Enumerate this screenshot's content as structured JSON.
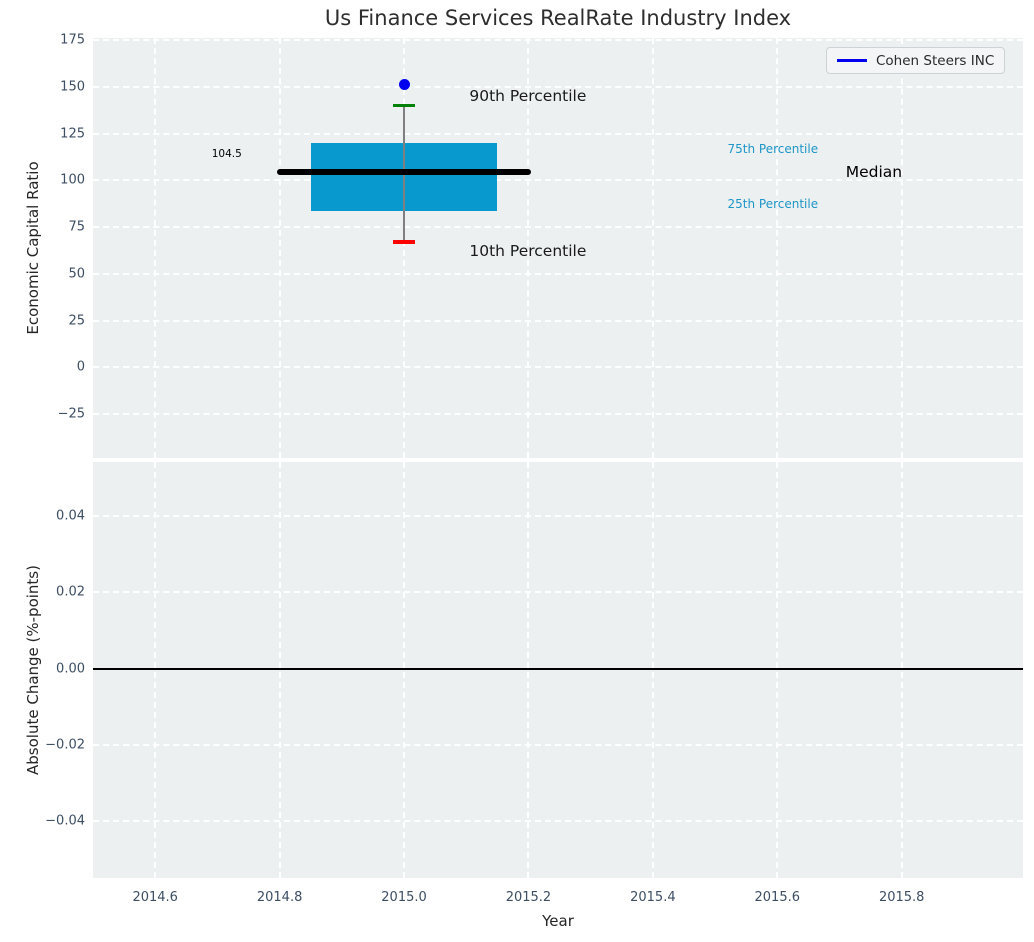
{
  "figure": {
    "background": "#ffffff",
    "axes_background": "#ecf0f1",
    "grid_color": "#ffffff",
    "tick_color": "#3d4e63"
  },
  "chart_data": [
    {
      "type": "boxplot",
      "title": "Us Finance Services RealRate Industry Index",
      "ylabel": "Economic Capital Ratio",
      "xlim": [
        2014.5,
        2015.995
      ],
      "ylim": [
        -48.5,
        176.1
      ],
      "grid": "white-dashed",
      "yticks": [
        {
          "v": 175,
          "label": "175"
        },
        {
          "v": 150,
          "label": "150"
        },
        {
          "v": 125,
          "label": "125"
        },
        {
          "v": 100,
          "label": "100"
        },
        {
          "v": 75,
          "label": "75"
        },
        {
          "v": 50,
          "label": "50"
        },
        {
          "v": 25,
          "label": "25"
        },
        {
          "v": 0,
          "label": "0"
        },
        {
          "v": -25,
          "label": "−25"
        }
      ],
      "xticks": [
        {
          "v": 2014.6,
          "label": ""
        },
        {
          "v": 2014.8,
          "label": ""
        },
        {
          "v": 2015.0,
          "label": ""
        },
        {
          "v": 2015.2,
          "label": ""
        },
        {
          "v": 2015.4,
          "label": ""
        },
        {
          "v": 2015.6,
          "label": ""
        },
        {
          "v": 2015.8,
          "label": ""
        }
      ],
      "legend": {
        "position": "upper-right",
        "entries": [
          {
            "label": "Cohen Steers INC",
            "color": "#0000ee"
          }
        ]
      },
      "groups": [
        {
          "x": 2015.0,
          "median": 104.5,
          "q1": 83.5,
          "q3": 120,
          "p10": 67,
          "p90": 140,
          "box_halfwidth": 0.15,
          "median_halfwidth": 0.2,
          "cap_halfwidth": 0.018,
          "box_color": "#089ace",
          "median_color": "#000000",
          "p90_color": "#008000",
          "p10_color": "#ff0000",
          "whisker_color": "#7f7f7f",
          "company_point": {
            "name": "Cohen Steers INC",
            "value": 151,
            "color": "#0000ee"
          }
        }
      ],
      "annotations": [
        {
          "text": "104.5",
          "x": 2014.715,
          "y": 114,
          "color": "#000000",
          "size": 10.5,
          "align": "center"
        },
        {
          "text": "90th Percentile",
          "x": 2015.105,
          "y": 145,
          "color": "#1a1a1a",
          "size": 15.5,
          "align": "left"
        },
        {
          "text": "10th Percentile",
          "x": 2015.105,
          "y": 62,
          "color": "#1a1a1a",
          "size": 15.5,
          "align": "left"
        },
        {
          "text": "75th Percentile",
          "x": 2015.52,
          "y": 117,
          "color": "#1e96c8",
          "size": 12,
          "align": "left"
        },
        {
          "text": "25th Percentile",
          "x": 2015.52,
          "y": 87.5,
          "color": "#1e96c8",
          "size": 12,
          "align": "left"
        },
        {
          "text": "Median",
          "x": 2015.71,
          "y": 104.5,
          "color": "#000000",
          "size": 15.5,
          "align": "left"
        }
      ]
    },
    {
      "type": "line",
      "ylabel": "Absolute Change (%-points)",
      "xlabel": "Year",
      "xlim": [
        2014.5,
        2015.995
      ],
      "ylim": [
        -0.0549,
        0.0542
      ],
      "grid": "white-dashed",
      "yticks": [
        {
          "v": 0.04,
          "label": "0.04"
        },
        {
          "v": 0.02,
          "label": "0.02"
        },
        {
          "v": 0.0,
          "label": "0.00"
        },
        {
          "v": -0.02,
          "label": "−0.02"
        },
        {
          "v": -0.04,
          "label": "−0.04"
        }
      ],
      "xticks": [
        {
          "v": 2014.6,
          "label": "2014.6"
        },
        {
          "v": 2014.8,
          "label": "2014.8"
        },
        {
          "v": 2015.0,
          "label": "2015.0"
        },
        {
          "v": 2015.2,
          "label": "2015.2"
        },
        {
          "v": 2015.4,
          "label": "2015.4"
        },
        {
          "v": 2015.6,
          "label": "2015.6"
        },
        {
          "v": 2015.8,
          "label": "2015.8"
        }
      ],
      "zero_line": {
        "y": 0.0,
        "color": "#000000"
      },
      "series": []
    }
  ]
}
